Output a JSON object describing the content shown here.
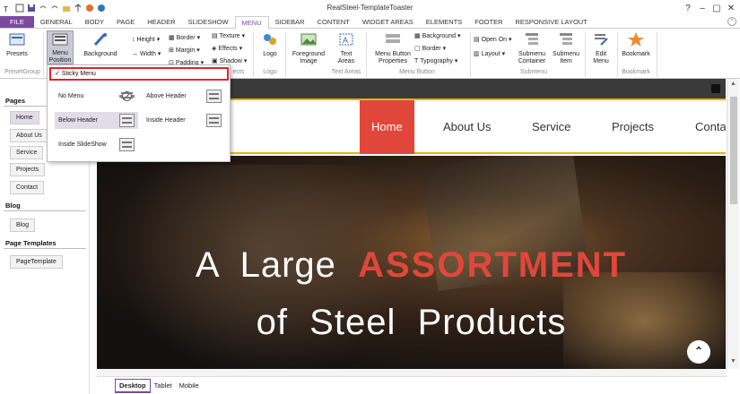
{
  "app": {
    "title": "RealSteel-TemplateToaster"
  },
  "tabs": [
    "FILE",
    "GENERAL",
    "BODY",
    "PAGE",
    "HEADER",
    "SLIDESHOW",
    "MENU",
    "SIDEBAR",
    "CONTENT",
    "WIDGET AREAS",
    "ELEMENTS",
    "FOOTER",
    "RESPONSIVE LAYOUT"
  ],
  "active_tab": "MENU",
  "ribbon": {
    "presets": "Presets",
    "preset_group": "PresetGroup",
    "menu_position": "Menu\nPosition",
    "background": "Background",
    "height": "Height",
    "width": "Width",
    "border": "Border",
    "margin": "Margin",
    "padding": "Padding",
    "texture": "Texture",
    "effects": "Effects",
    "shadow": "Shadow",
    "effects_group": "ects",
    "logo": "Logo",
    "logo_group": "Logo",
    "foreground_image": "Foreground\nImage",
    "text_areas": "Text\nAreas",
    "text_areas_group": "Text Areas",
    "menu_button_properties": "Menu Button\nProperties",
    "mb_background": "Background",
    "mb_border": "Border",
    "mb_typography": "Typography",
    "menu_button_group": "Menu Button",
    "open_on": "Open On",
    "layout": "Layout",
    "submenu_container": "Submenu\nContainer",
    "submenu_item": "Submenu\nItem",
    "submenu_group": "Submenu",
    "edit_menu": "Edit\nMenu",
    "bookmark": "Bookmark",
    "bookmark_group": "Bookmark"
  },
  "dropdown": {
    "sticky_menu": "✓  Sticky Menu",
    "no_menu": "No Menu",
    "above_header": "Above Header",
    "below_header": "Below Header",
    "inside_header": "Inside Header",
    "inside_slideshow": "Inside SlideShow"
  },
  "sidebar": {
    "pages_title": "Pages",
    "pages": [
      "Home",
      "About Us",
      "Service",
      "Projects",
      "Contact"
    ],
    "active_page": "Home",
    "blog_title": "Blog",
    "blog_items": [
      "Blog"
    ],
    "templates_title": "Page Templates",
    "template_items": [
      "PageTemplate"
    ]
  },
  "site": {
    "nav": [
      "Home",
      "About Us",
      "Service",
      "Projects",
      "Contac"
    ],
    "hero_line1_a": "A  Large  ",
    "hero_line1_b": "ASSORTMENT",
    "hero_line2": "of  Steel  Products",
    "up_arrow": "⌃"
  },
  "bottom_tabs": [
    "Desktop",
    "Tablet",
    "Mobile"
  ],
  "active_bottom_tab": "Desktop",
  "colors": {
    "accent": "#7b4a9e",
    "nav_active": "#e0473a",
    "highlight_border": "#e0242a",
    "yellow_line": "#e2b400"
  }
}
